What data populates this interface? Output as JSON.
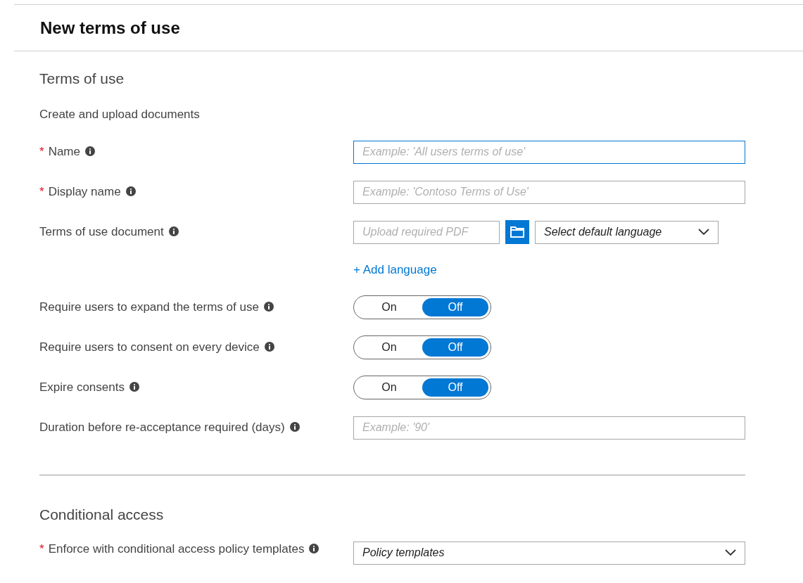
{
  "header": {
    "title": "New terms of use"
  },
  "sections": [
    {
      "heading": "Terms of use",
      "subheading": "Create and upload documents",
      "fields": [
        {
          "kind": "text",
          "required_mark": "*",
          "label": "Name",
          "info": true,
          "placeholder": "Example: 'All users terms of use'",
          "focused": true
        },
        {
          "kind": "text",
          "required_mark": "*",
          "label": "Display name",
          "info": true,
          "placeholder": "Example: 'Contoso Terms of Use'",
          "focused": false
        },
        {
          "kind": "upload",
          "label": "Terms of use document",
          "info": true,
          "placeholder": "Upload required PDF",
          "select": "Select default language"
        },
        {
          "kind": "link",
          "text": "+ Add language"
        },
        {
          "kind": "toggle",
          "label": "Require users to expand the terms of use",
          "info": true,
          "on_label": "On",
          "off_label": "Off",
          "on": false
        },
        {
          "kind": "toggle",
          "label": "Require users to consent on every device",
          "info": true,
          "on_label": "On",
          "off_label": "Off",
          "on": false
        },
        {
          "kind": "toggle",
          "label": "Expire consents",
          "info": true,
          "on_label": "On",
          "off_label": "Off",
          "on": false
        },
        {
          "kind": "text",
          "label": "Duration before re-acceptance required (days)",
          "info": true,
          "placeholder": "Example: '90'",
          "focused": false
        }
      ]
    },
    {
      "heading": "Conditional access",
      "fields": [
        {
          "kind": "select",
          "required_mark": "*",
          "label": "Enforce with conditional access policy templates",
          "info": true,
          "value": "Policy templates"
        }
      ]
    }
  ]
}
